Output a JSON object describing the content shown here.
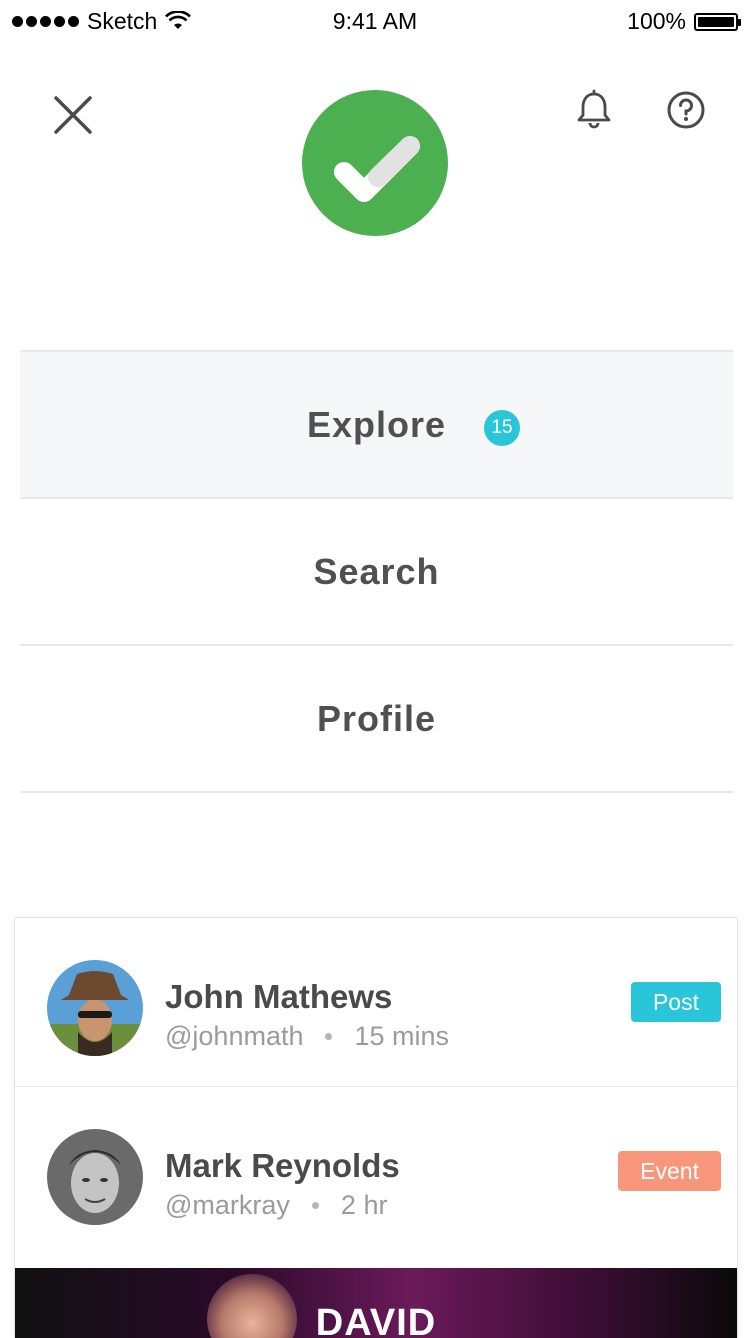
{
  "status_bar": {
    "carrier": "Sketch",
    "time": "9:41 AM",
    "battery": "100%"
  },
  "header": {
    "close_icon": "close-icon",
    "logo_icon": "check-icon",
    "bell_icon": "bell-icon",
    "help_icon": "help-circle-icon",
    "logo_color": "#4caf50"
  },
  "menu": {
    "items": [
      {
        "label": "Explore",
        "badge": "15",
        "active": true
      },
      {
        "label": "Search"
      },
      {
        "label": "Profile"
      }
    ]
  },
  "feed": {
    "items": [
      {
        "name": "John Mathews",
        "handle": "@johnmath",
        "time": "15 mins",
        "tag": "Post",
        "tag_color": "#29c5d8"
      },
      {
        "name": "Mark Reynolds",
        "handle": "@markray",
        "time": "2 hr",
        "tag": "Event",
        "tag_color": "#f7967a"
      }
    ],
    "banner_title": "DAVID"
  }
}
